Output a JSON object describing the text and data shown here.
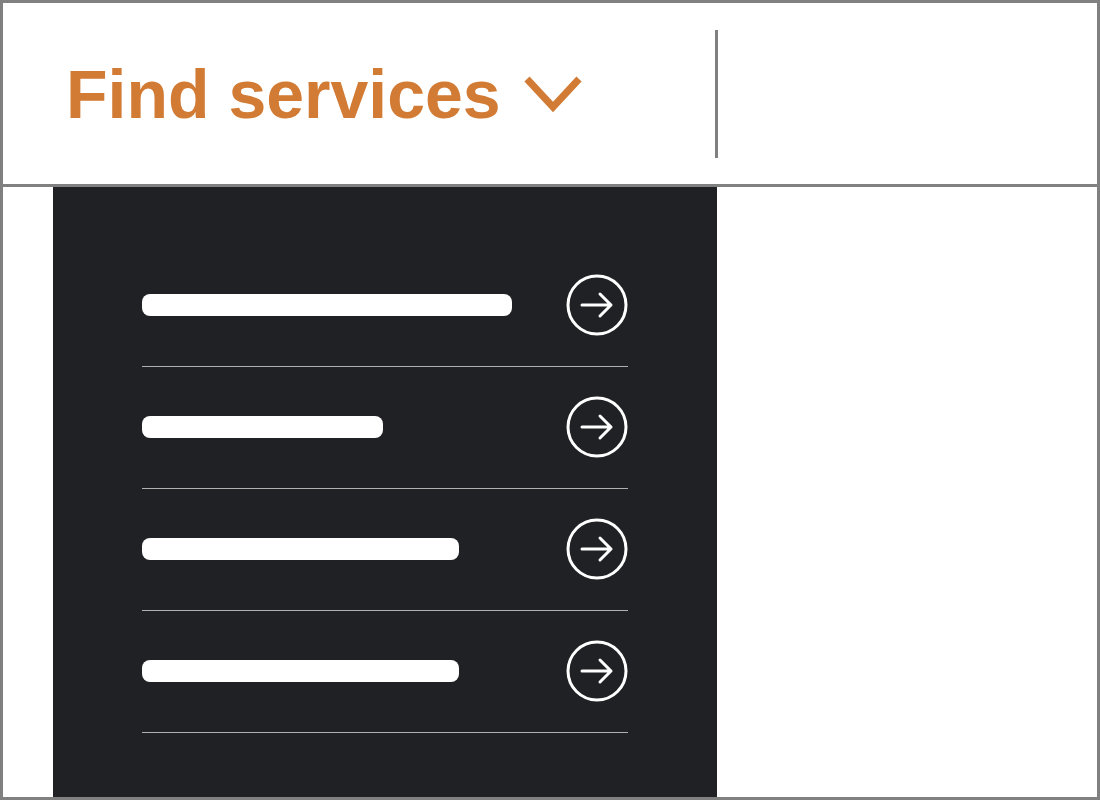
{
  "nav": {
    "label": "Find services",
    "expanded": true
  },
  "dropdown": {
    "items": [
      {
        "kind": "link"
      },
      {
        "kind": "link"
      },
      {
        "kind": "link"
      },
      {
        "kind": "link"
      }
    ]
  }
}
